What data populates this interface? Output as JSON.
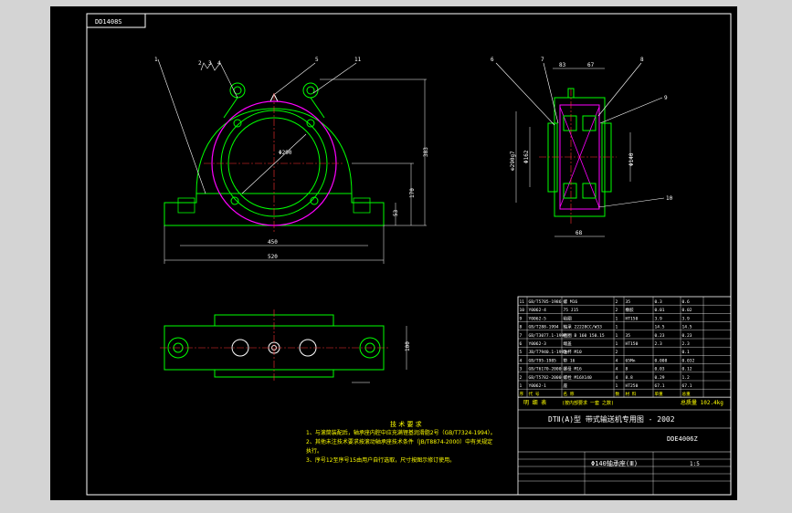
{
  "colors": {
    "background": "#d4d4d4",
    "paper": "#000000",
    "frame": "#ffffff",
    "outline": "#00ff00",
    "circle": "#ff00ff",
    "dimension": "#00ffff",
    "note": "#ffff00",
    "red": "#ff3030"
  },
  "drawing_code_box": "DD1408S",
  "balloons": {
    "front": [
      "1",
      "2",
      "3",
      "4",
      "5",
      "11"
    ],
    "side": [
      "6",
      "7",
      "8",
      "9",
      "10"
    ]
  },
  "dimensions": {
    "front": {
      "diameter": "Φ290",
      "height_total": "383",
      "height_center": "170",
      "base_height": "53",
      "bolt_span": "450",
      "base_width": "520"
    },
    "side": {
      "d1": "⊕290g7",
      "d2": "Φ162",
      "d3": "Φ140",
      "w_top_left": "83",
      "w_top_right": "67",
      "bottom": "68"
    },
    "plan": {
      "right": "100"
    }
  },
  "notes": {
    "heading": "技 术 要 求",
    "lines": [
      "1、与滚筒装配后，轴承座内腔中应充满锂基润滑脂2号（GB/T7324-1994）。",
      "2、其他未注技术要求按滚动轴承座技术条件（JB/T8874-2000）中有关规定",
      "执行。",
      "3、序号12至序号15由用户自行选取，尺寸按图示修订使用。"
    ]
  },
  "bom": {
    "rows": [
      [
        "11",
        "GB/T5785-1986",
        "螺 M16",
        "2",
        "35",
        "0.3",
        "0.6"
      ],
      [
        "10",
        "Y0062-4",
        "75 J15",
        "2",
        "橡胶",
        "0.01",
        "0.02"
      ],
      [
        "9",
        "Y0062-5",
        "毡圈",
        "1",
        "HT150",
        "3.9",
        "3.9"
      ],
      [
        "8",
        "GB/T288-1994",
        "轴承 22228CC/W33",
        "1",
        "",
        "14.5",
        "14.5"
      ],
      [
        "7",
        "GB/T3077.1-1998",
        "挡圈 B 160 150.15",
        "1",
        "35",
        "0.23",
        "0.23"
      ],
      [
        "6",
        "Y0062-3",
        "端盖",
        "1",
        "HT150",
        "2.3",
        "2.3"
      ],
      [
        "5",
        "JB/T7940.1-1995",
        "油杯 M10",
        "2",
        "",
        "",
        "0.1"
      ],
      [
        "4",
        "GB/T95-1985",
        "垫 16",
        "4",
        "65Mn",
        "0.008",
        "0.032"
      ],
      [
        "3",
        "GB/T6170-2000",
        "螺母 M16",
        "4",
        "8",
        "0.03",
        "0.12"
      ],
      [
        "2",
        "GB/T5782-2000",
        "螺栓 M16X140",
        "4",
        "8.8",
        "0.29",
        "1.2"
      ],
      [
        "1",
        "Y0062-1",
        "座",
        "1",
        "HT250",
        "67.1",
        "67.1"
      ]
    ],
    "header": [
      "序",
      "代 号",
      "名 称",
      "数",
      "材 料",
      "单重",
      "总重"
    ],
    "footer_label": "明 细 表",
    "footer_sub": "(按内部要求 一套 之数)",
    "total_weight": "总质量 102.4kg",
    "series_title": "DTⅡ(A)型 带式输送机专用图 - 2002",
    "drawing_no": "DDE4006Z",
    "part_title": "Φ140轴承座(Ⅲ)",
    "scale": "1:5"
  }
}
